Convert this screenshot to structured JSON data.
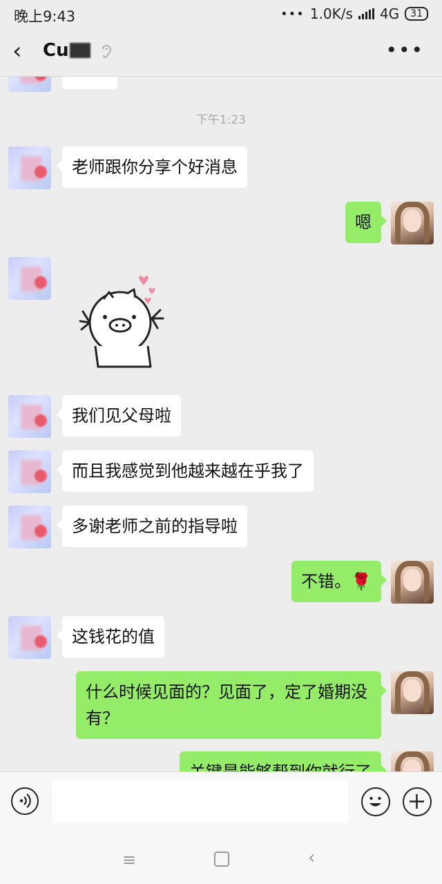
{
  "status_bar": {
    "time": "晚上9:43",
    "dots": "•••",
    "speed": "1.0K/s",
    "network": "4G",
    "network_suffix": "ıl",
    "battery": "31"
  },
  "header": {
    "back_glyph": "‹",
    "title": "Cu",
    "more_glyph": "•••"
  },
  "messages": [
    {
      "id": "ts1",
      "type": "timestamp",
      "text": "下午1:23"
    },
    {
      "id": "m1",
      "side": "left",
      "text": "老师跟你分享个好消息"
    },
    {
      "id": "m2",
      "side": "right",
      "text": "嗯"
    },
    {
      "id": "m3",
      "side": "left",
      "type": "sticker",
      "sticker": "pig-hearts"
    },
    {
      "id": "m4",
      "side": "left",
      "text": "我们见父母啦"
    },
    {
      "id": "m5",
      "side": "left",
      "text": "而且我感觉到他越来越在乎我了"
    },
    {
      "id": "m6",
      "side": "left",
      "text": "多谢老师之前的指导啦"
    },
    {
      "id": "m7",
      "side": "right",
      "text": "不错。🌹"
    },
    {
      "id": "m8",
      "side": "left",
      "text": "这钱花的值"
    },
    {
      "id": "m9",
      "side": "right",
      "text": "什么时候见面的？见面了，定了婚期没有？"
    },
    {
      "id": "m10",
      "side": "right",
      "text": "关键是能够帮到你就行了"
    }
  ],
  "input_bar": {
    "voice_icon": "voice-icon",
    "emoji_icon": "emoji-icon",
    "plus_icon": "plus-icon",
    "text_value": ""
  },
  "system_nav": {
    "menu_glyph": "≡",
    "back_glyph": "‹"
  },
  "colors": {
    "background": "#ededed",
    "bubble_left": "#ffffff",
    "bubble_right": "#95ec69",
    "timestamp": "#a9a9a9"
  }
}
